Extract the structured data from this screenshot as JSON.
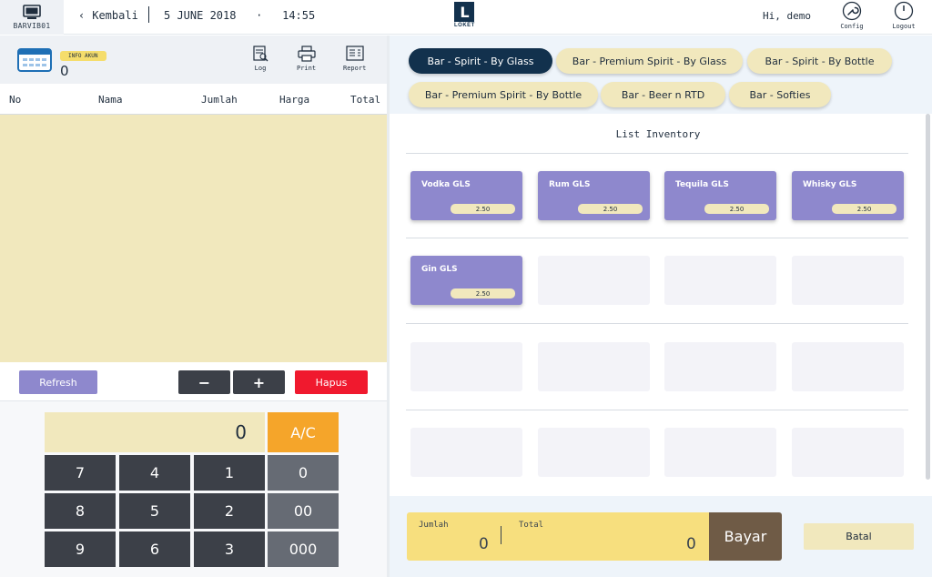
{
  "header": {
    "station": "BARVIB01",
    "back_label": "Kembali",
    "date": "5 JUNE 2018",
    "dot": "·",
    "time": "14:55",
    "logo_letter": "L",
    "logo_text": "LOKÉT",
    "greeting": "Hi, demo",
    "config_label": "Config",
    "logout_label": "Logout"
  },
  "account": {
    "badge": "INFO AKUN",
    "value": "0"
  },
  "toolbar": {
    "log_label": "Log",
    "print_label": "Print",
    "report_label": "Report"
  },
  "table": {
    "columns": [
      "No",
      "Nama",
      "Jumlah",
      "Harga",
      "Total"
    ]
  },
  "controls": {
    "refresh_label": "Refresh",
    "minus_label": "−",
    "plus_label": "+",
    "hapus_label": "Hapus"
  },
  "keypad": {
    "display": "0",
    "clear_label": "A/C",
    "keys": [
      "7",
      "4",
      "1",
      "0",
      "8",
      "5",
      "2",
      "00",
      "9",
      "6",
      "3",
      "000"
    ]
  },
  "categories": [
    {
      "label": "Bar - Spirit - By Glass",
      "active": true
    },
    {
      "label": "Bar - Premium Spirit - By Glass",
      "active": false
    },
    {
      "label": "Bar - Spirit - By Bottle",
      "active": false
    },
    {
      "label": "Bar - Premium Spirit - By Bottle",
      "active": false
    },
    {
      "label": "Bar - Beer n RTD",
      "active": false
    },
    {
      "label": "Bar - Softies",
      "active": false
    }
  ],
  "inventory": {
    "title": "List Inventory",
    "items": [
      {
        "name": "Vodka GLS",
        "price": "2.50"
      },
      {
        "name": "Rum GLS",
        "price": "2.50"
      },
      {
        "name": "Tequila GLS",
        "price": "2.50"
      },
      {
        "name": "Whisky GLS",
        "price": "2.50"
      },
      {
        "name": "Gin GLS",
        "price": "2.50"
      }
    ]
  },
  "payment": {
    "jumlah_label": "Jumlah",
    "jumlah_value": "0",
    "total_label": "Total",
    "total_value": "0",
    "pay_label": "Bayar",
    "cancel_label": "Batal"
  },
  "colors": {
    "accent_navy": "#12314d",
    "cream": "#f1e8bd",
    "purple": "#8e88cd",
    "orange": "#f5a52a",
    "red": "#f0192e",
    "brown": "#6f5b46"
  }
}
